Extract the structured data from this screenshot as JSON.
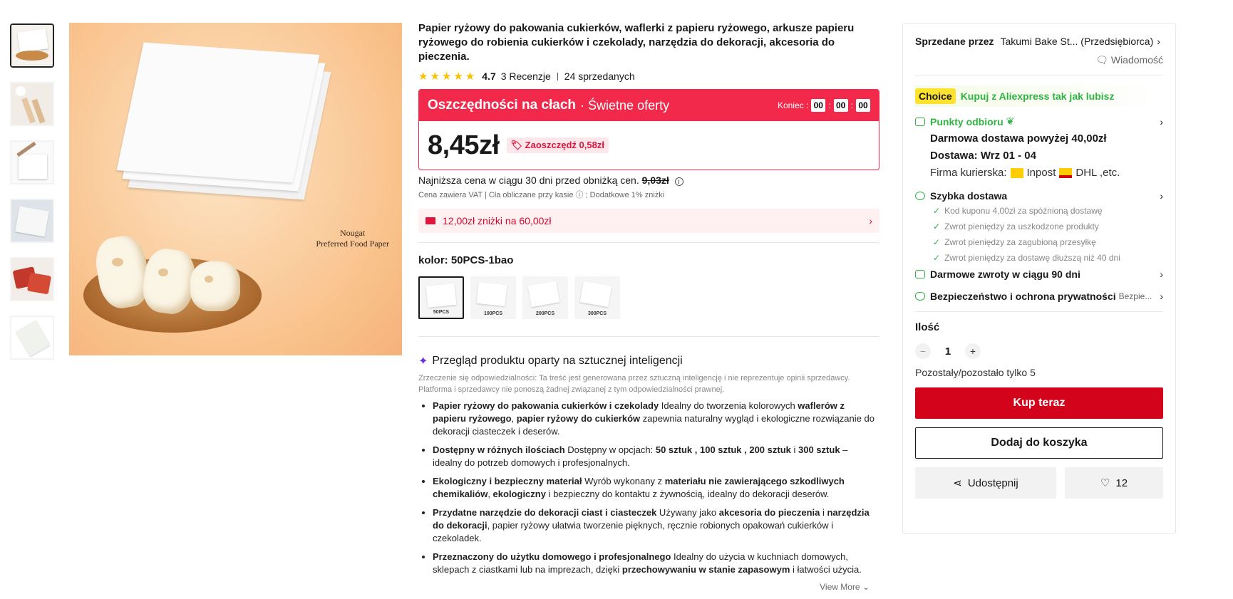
{
  "product": {
    "title": "Papier ryżowy do pakowania cukierków, waflerki z papieru ryżowego, arkusze papieru ryżowego do robienia cukierków i czekolady, narzędzia do dekoracji, akcesoria do pieczenia.",
    "rating": "4.7",
    "reviews": "3 Recenzje",
    "sold": "24 sprzedanych",
    "image_caption_1": "Nougat",
    "image_caption_2": "Preferred Food Paper"
  },
  "deal": {
    "title": "Oszczędności na cłach",
    "subtitle": "· Świetne oferty",
    "end_label": "Koniec :",
    "h": "00",
    "m": "00",
    "s": "00",
    "price": "8,45zł",
    "save": "Zaoszczędź 0,58zł"
  },
  "lowest": {
    "text": "Najniższa cena w ciągu 30 dni przed obniżką cen.",
    "old_price": "9,03zł",
    "vat": "Cena zawiera VAT | Cła obliczane przy kasie ⓘ ; Dodatkowe 1% zniżki"
  },
  "coupon": {
    "text": "12,00zł zniżki na 60,00zł"
  },
  "color": {
    "label": "kolor: 50PCS-1bao",
    "options": [
      "50PCS",
      "100PCS",
      "200PCS",
      "300PCS"
    ]
  },
  "ai": {
    "heading": "Przegląd produktu oparty na sztucznej inteligencji",
    "disclaimer": "Zrzeczenie się odpowiedzialności: Ta treść jest generowana przez sztuczną inteligencję i nie reprezentuje opinii sprzedawcy. Platforma i sprzedawcy nie ponoszą żadnej związanej z tym odpowiedzialności prawnej.",
    "bullets": [
      {
        "b": "Papier ryżowy do pakowania cukierków i czekolady",
        "t": " Idealny do tworzenia kolorowych ",
        "b2": "waflerów z papieru ryżowego",
        "t2": ", ",
        "b3": "papier ryżowy do cukierków",
        "t3": " zapewnia naturalny wygląd i ekologiczne rozwiązanie do dekoracji ciasteczek i deserów."
      },
      {
        "b": "Dostępny w różnych ilościach",
        "t": " Dostępny w opcjach: ",
        "b2": "50 sztuk , 100 sztuk , 200 sztuk",
        "t2": "  i ",
        "b3": "300 sztuk",
        "t3": "  – idealny do potrzeb domowych i profesjonalnych."
      },
      {
        "b": "Ekologiczny i bezpieczny materiał",
        "t": " Wyrób wykonany z ",
        "b2": "materiału nie zawierającego szkodliwych chemikaliów",
        "t2": ", ",
        "b3": "ekologiczny",
        "t3": " i bezpieczny do kontaktu z żywnością, idealny do dekoracji deserów."
      },
      {
        "b": "Przydatne narzędzie do dekoracji ciast i ciasteczek",
        "t": " Używany jako ",
        "b2": "akcesoria do pieczenia",
        "t2": " i ",
        "b3": "narzędzia do dekoracji",
        "t3": ", papier ryżowy ułatwia tworzenie pięknych, ręcznie robionych opakowań cukierków i czekoladek."
      },
      {
        "b": "Przeznaczony do użytku domowego i profesjonalnego",
        "t": " Idealny do użycia w kuchniach domowych, sklepach z ciastkami lub na imprezach, dzięki ",
        "b2": "przechowywaniu w stanie zapasowym",
        "t2": " i łatwości użycia.",
        "b3": "",
        "t3": ""
      }
    ],
    "view_more": "View More"
  },
  "side": {
    "sold_by_label": "Sprzedane przez",
    "seller": "Takumi Bake St... (Przedsiębiorca)",
    "message": "Wiadomość",
    "choice_badge": "Choice",
    "choice_text": "Kupuj z Aliexpress tak jak lubisz",
    "pickup": "Punkty odbioru",
    "free_ship": "Darmowa dostawa powyżej 40,00zł",
    "delivery": "Dostawa: Wrz 01 - 04",
    "courier_label": "Firma kurierska:",
    "courier_1": "Inpost",
    "courier_2": "DHL ,etc.",
    "fast": "Szybka dostawa",
    "checks": [
      "Kod kuponu 4,00zł za spóźnioną dostawę",
      "Zwrot pieniędzy za uszkodzone produkty",
      "Zwrot pieniędzy za zagubioną przesyłkę",
      "Zwrot pieniędzy za dostawę dłuższą niż 40 dni"
    ],
    "returns": "Darmowe zwroty w ciągu 90 dni",
    "security": "Bezpieczeństwo i ochrona prywatności",
    "security_more": "Bezpie...",
    "qty_label": "Ilość",
    "qty": "1",
    "remaining": "Pozostały/pozostało tylko 5",
    "buy": "Kup teraz",
    "cart": "Dodaj do koszyka",
    "share": "Udostępnij",
    "likes": "12"
  },
  "colors": {
    "accent": "#f2294b",
    "buy": "#d3031c",
    "green": "#2fb342"
  }
}
